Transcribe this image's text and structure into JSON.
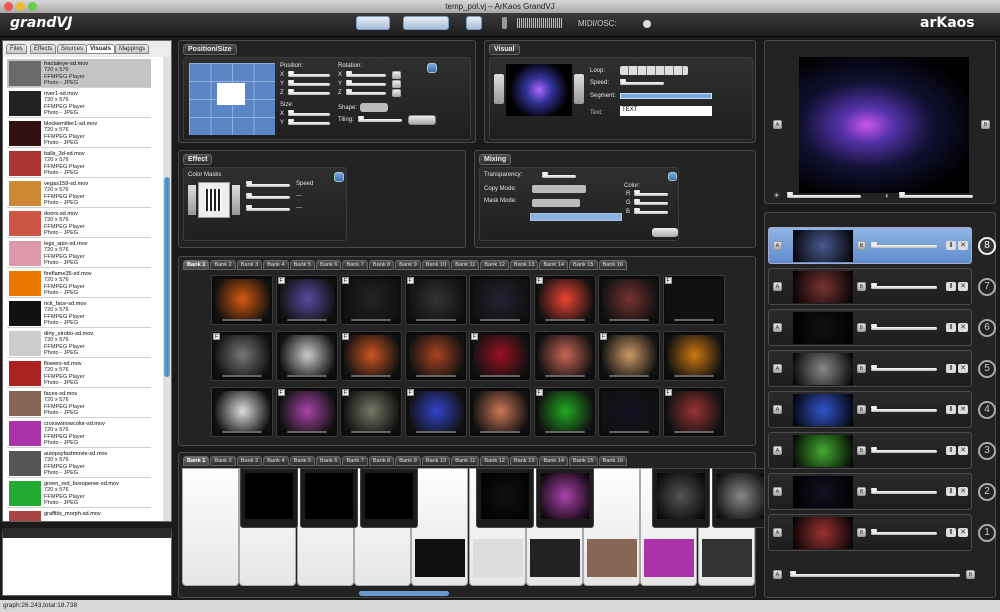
{
  "window": {
    "title": "temp_pol.vj – ArKaos GrandVJ"
  },
  "app": {
    "logo_left": "grandVJ",
    "logo_right": "arKaos",
    "midi_label": "MIDI/OSC:"
  },
  "browser": {
    "tabs": [
      "Files",
      "Effects",
      "Sources",
      "Visuals",
      "Mappings"
    ],
    "active_tab": "Visuals",
    "items": [
      {
        "name": "fractaleye-sd.mov",
        "size": "720 x 576",
        "player": "FFMPEG Player",
        "codec": "Photo - JPEG",
        "thumb": "#6a6a6a"
      },
      {
        "name": "river1-sd.mov",
        "size": "720 x 576",
        "player": "FFMPEG Player",
        "codec": "Photo - JPEG",
        "thumb": "#222"
      },
      {
        "name": "blockemitter1-sd.mov",
        "size": "720 x 576",
        "player": "FFMPEG Player",
        "codec": "Photo - JPEG",
        "thumb": "#311"
      },
      {
        "name": "balls_3d-sd.mov",
        "size": "720 x 576",
        "player": "FFMPEG Player",
        "codec": "Photo - JPEG",
        "thumb": "#a33"
      },
      {
        "name": "vegas159-sd.mov",
        "size": "720 x 576",
        "player": "FFMPEG Player",
        "codec": "Photo - JPEG",
        "thumb": "#c83"
      },
      {
        "name": "doors-sd.mov",
        "size": "720 x 576",
        "player": "FFMPEG Player",
        "codec": "Photo - JPEG",
        "thumb": "#c54"
      },
      {
        "name": "legs_spin-sd.mov",
        "size": "720 x 576",
        "player": "FFMPEG Player",
        "codec": "Photo - JPEG",
        "thumb": "#d9a"
      },
      {
        "name": "fireflame35-sd.mov",
        "size": "720 x 576",
        "player": "FFMPEG Player",
        "codec": "Photo - JPEG",
        "thumb": "#e70"
      },
      {
        "name": "rick_face-sd.mov",
        "size": "720 x 576",
        "player": "FFMPEG Player",
        "codec": "Photo - JPEG",
        "thumb": "#111"
      },
      {
        "name": "dirty_strobo-sd.mov",
        "size": "720 x 576",
        "player": "FFMPEG Player",
        "codec": "Photo - JPEG",
        "thumb": "#ccc"
      },
      {
        "name": "flowers-sd.mov",
        "size": "720 x 576",
        "player": "FFMPEG Player",
        "codec": "Photo - JPEG",
        "thumb": "#a22"
      },
      {
        "name": "faces-sd.mov",
        "size": "720 x 576",
        "player": "FFMPEG Player",
        "codec": "Photo - JPEG",
        "thumb": "#865"
      },
      {
        "name": "crosswinowcolor-sd.mov",
        "size": "720 x 576",
        "player": "FFMPEG Player",
        "codec": "Photo - JPEG",
        "thumb": "#a3a"
      },
      {
        "name": "autopsyfastmovie-sd.mov",
        "size": "720 x 576",
        "player": "FFMPEG Player",
        "codec": "Photo - JPEG",
        "thumb": "#555"
      },
      {
        "name": "green_red_boxopener-sd.mov",
        "size": "720 x 576",
        "player": "FFMPEG Player",
        "codec": "Photo - JPEG",
        "thumb": "#2a3"
      },
      {
        "name": "graffitis_morph-sd.mov",
        "size": "",
        "player": "",
        "codec": "",
        "thumb": "#a44"
      }
    ]
  },
  "position": {
    "title": "Position/Size",
    "position_label": "Position:",
    "rotation_label": "Rotation:",
    "size_label": "Size:",
    "shape_label": "Shape:",
    "tiling_label": "Tiling:",
    "x": "X",
    "y": "Y",
    "z": "Z"
  },
  "visual": {
    "title": "Visual",
    "loop_label": "Loop:",
    "speed_label": "Speed:",
    "segment_label": "Segment:",
    "text_label": "Text:",
    "text_value": "TEXT"
  },
  "effect": {
    "title": "Effect",
    "color_masks_label": "Color Masks",
    "speed_label": "Speed",
    "dash1": "---",
    "dash2": "---"
  },
  "mixing": {
    "title": "Mixing",
    "transparency_label": "Transparency:",
    "copy_mode_label": "Copy Mode:",
    "mask_mode_label": "Mask Mode:",
    "color_label": "Color:",
    "r": "R",
    "g": "G",
    "b": "B"
  },
  "banks": [
    "Bank 1",
    "Bank 2",
    "Bank 3",
    "Bank 4",
    "Bank 5",
    "Bank 6",
    "Bank 7",
    "Bank 8",
    "Bank 9",
    "Bank 10",
    "Bank 11",
    "Bank 12",
    "Bank 13",
    "Bank 14",
    "Bank 15",
    "Bank 16"
  ],
  "grid": {
    "badge": "F",
    "rows": [
      [
        "#d55a10",
        "#5a4aa0",
        "#222",
        "#333",
        "#223",
        "#e43",
        "#733",
        "#111"
      ],
      [
        "#777",
        "#ccc",
        "#c52",
        "#a42",
        "#912",
        "#c65",
        "#c96",
        "#c71"
      ],
      [
        "#ddd",
        "#a4a",
        "#776",
        "#34c",
        "#c75",
        "#2a2",
        "#112",
        "#933"
      ]
    ]
  },
  "preview": {
    "a_label": "A",
    "b_label": "B"
  },
  "layers": [
    {
      "num": "8",
      "thumb": "#4a5a90",
      "selected": true
    },
    {
      "num": "7",
      "thumb": "#733",
      "selected": false
    },
    {
      "num": "6",
      "thumb": "#111",
      "selected": false
    },
    {
      "num": "5",
      "thumb": "#888",
      "selected": false
    },
    {
      "num": "4",
      "thumb": "#35c",
      "selected": false
    },
    {
      "num": "3",
      "thumb": "#4a3",
      "selected": false
    },
    {
      "num": "2",
      "thumb": "#112",
      "selected": false
    },
    {
      "num": "1",
      "thumb": "#933",
      "selected": false
    }
  ],
  "layer_ab": {
    "a": "A",
    "b": "B"
  },
  "status": {
    "text": "graph:26.243,total:18.738"
  },
  "colors": {
    "accent": "#4a7cc0",
    "panel": "#232323"
  }
}
